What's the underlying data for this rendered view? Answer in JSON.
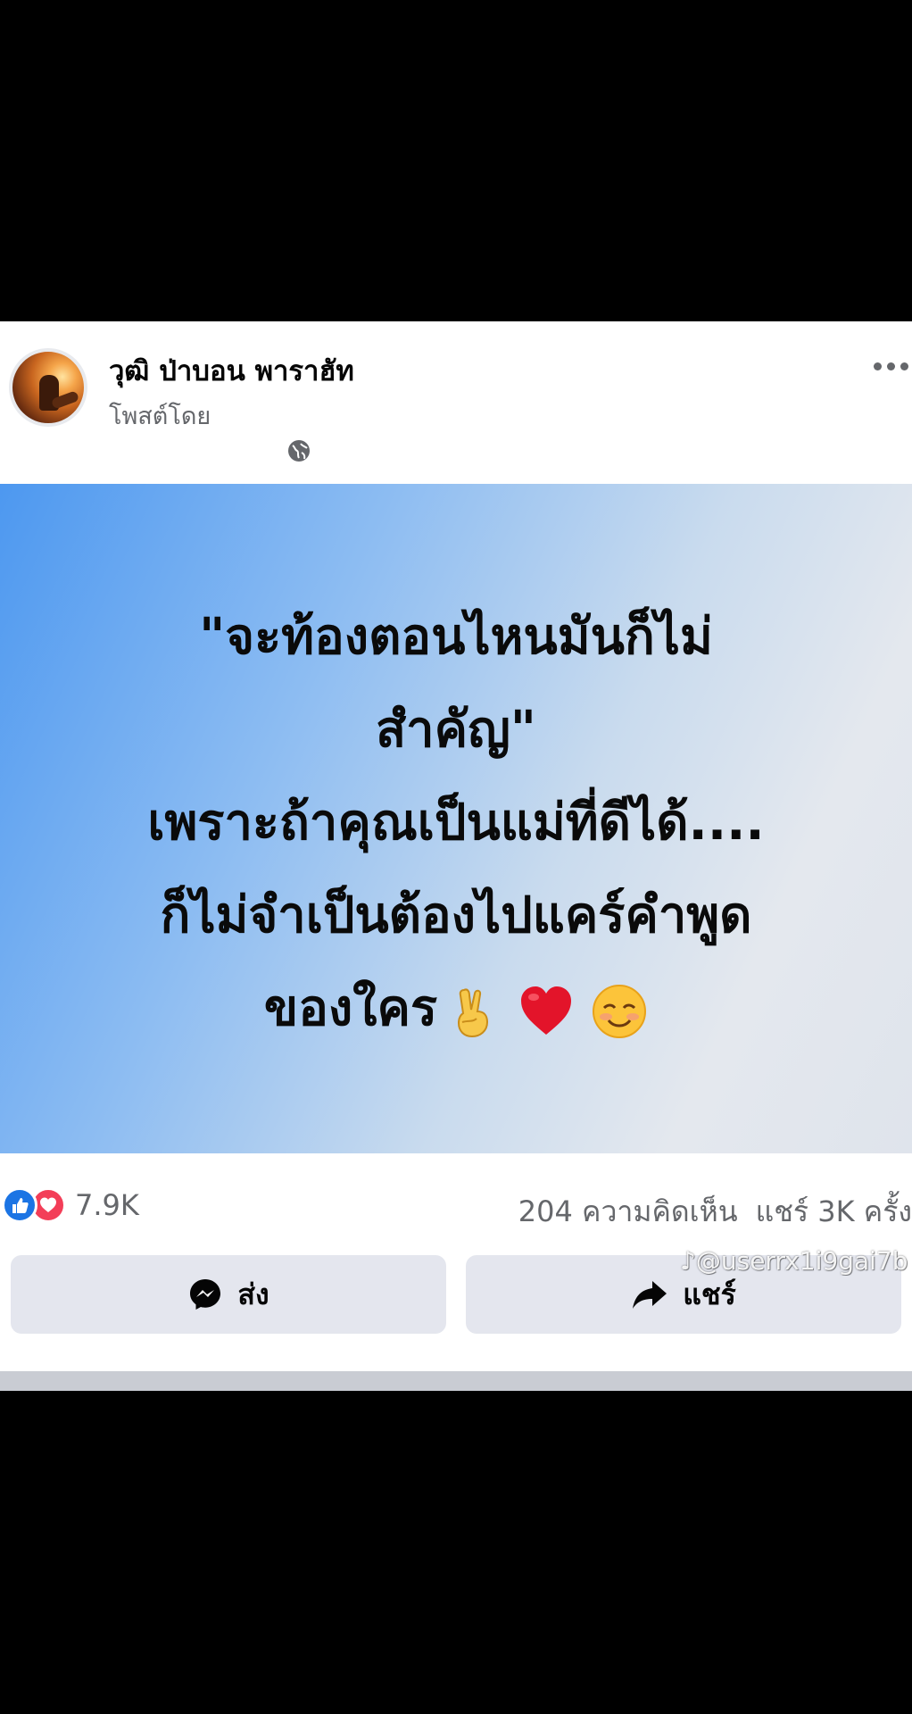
{
  "post": {
    "author_name": "วุฒิ ป่าบอน พาราฮัท",
    "posted_by": "โพสต์โดย",
    "privacy_icon": "globe-icon",
    "more_icon": "more-dots-icon"
  },
  "image": {
    "lines": [
      "\"จะท้องตอนไหนมันก็ไม่",
      "สำคัญ\"",
      "เพราะถ้าคุณเป็นแม่ที่ดีได้....",
      "ก็ไม่จำเป็นต้องไปแคร์คำพูด",
      "ของใคร"
    ],
    "emojis": [
      "victory-hand-emoji",
      "red-heart-emoji",
      "smiling-face-emoji"
    ]
  },
  "stats": {
    "reaction_count": "7.9K",
    "comments": "204 ความคิดเห็น",
    "shares": "แชร์ 3K ครั้ง"
  },
  "actions": {
    "send_label": "ส่ง",
    "share_label": "แชร์"
  },
  "watermark": "♪@userrx1i9gai7b",
  "colors": {
    "like_blue": "#1b74e4",
    "love_red": "#f33e58",
    "meta_gray": "#65676b",
    "button_bg": "#e4e6ee"
  }
}
